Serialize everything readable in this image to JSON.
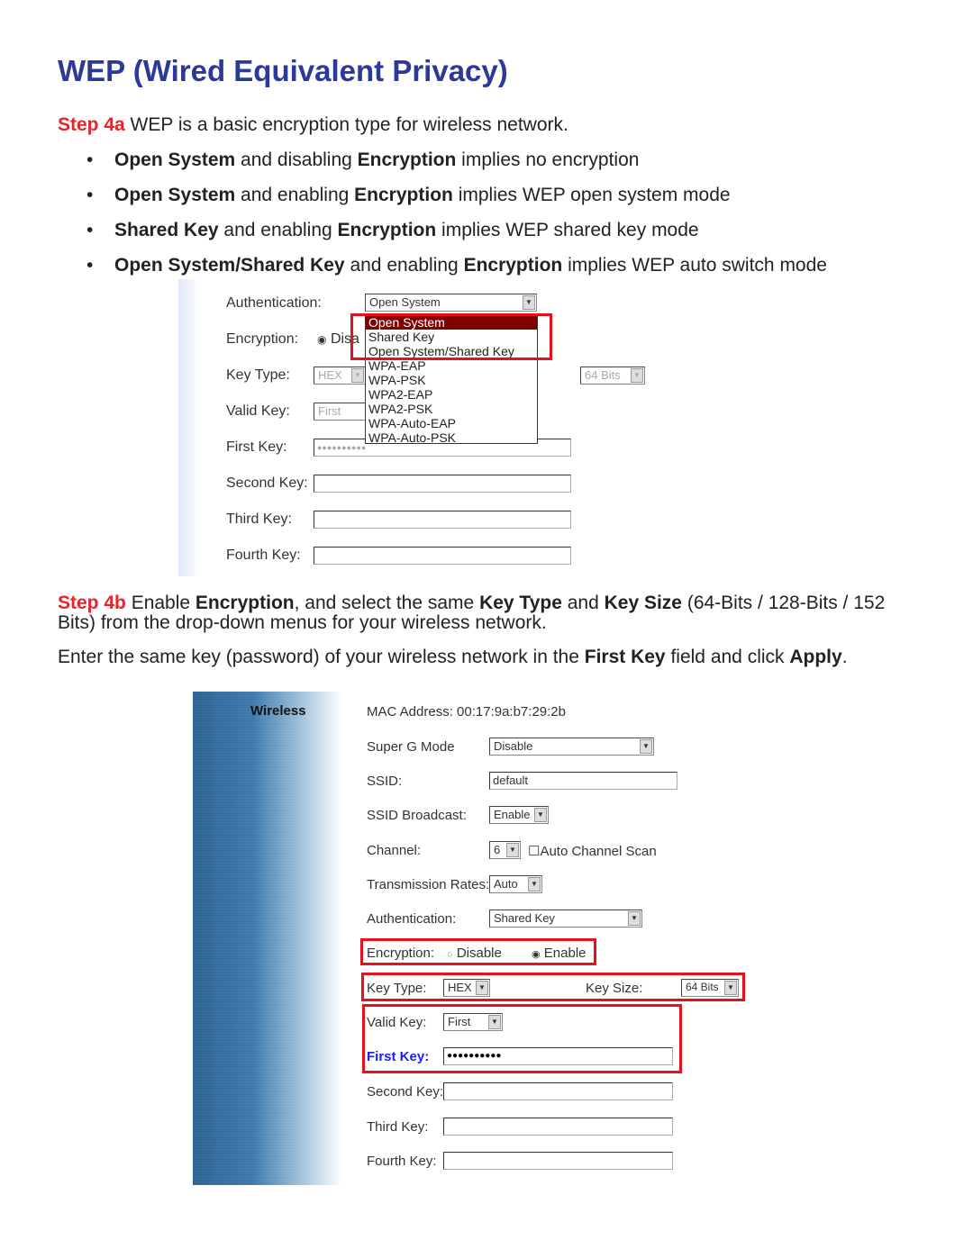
{
  "title": "WEP (Wired Equivalent Privacy)",
  "step4a": {
    "label": "Step 4a",
    "text": " WEP is a basic encryption type for wireless network."
  },
  "bullets": [
    [
      {
        "b": "Open System"
      },
      {
        "t": " and disabling "
      },
      {
        "b": "Encryption"
      },
      {
        "t": " implies no encryption"
      }
    ],
    [
      {
        "b": "Open System"
      },
      {
        "t": " and enabling "
      },
      {
        "b": "Encryption"
      },
      {
        "t": " implies WEP open system mode"
      }
    ],
    [
      {
        "b": "Shared Key"
      },
      {
        "t": " and enabling "
      },
      {
        "b": "Encryption"
      },
      {
        "t": " implies WEP shared key mode"
      }
    ],
    [
      {
        "b": "Open System/Shared Key"
      },
      {
        "t": " and enabling "
      },
      {
        "b": "Encryption"
      },
      {
        "t": " implies WEP auto switch mode"
      }
    ]
  ],
  "shot1": {
    "authentication_label": "Authentication:",
    "authentication_value": "Open System",
    "encryption_label": "Encryption:",
    "encryption_value": "Disa",
    "key_type_label": "Key Type:",
    "key_type_value": "HEX",
    "key_size_value": "64 Bits",
    "valid_key_label": "Valid Key:",
    "valid_key_value": "First",
    "first_key_label": "First Key:",
    "first_key_value": "●●●●●●●●●●",
    "second_key_label": "Second Key:",
    "third_key_label": "Third Key:",
    "fourth_key_label": "Fourth Key:",
    "options": [
      "Open System",
      "Shared Key",
      "Open System/Shared Key",
      "WPA-EAP",
      "WPA-PSK",
      "WPA2-EAP",
      "WPA2-PSK",
      "WPA-Auto-EAP",
      "WPA-Auto-PSK"
    ]
  },
  "step4b": {
    "label": "Step 4b",
    "line1": [
      {
        "t": " Enable "
      },
      {
        "b": "Encryption"
      },
      {
        "t": ", and select the same "
      },
      {
        "b": "Key Type"
      },
      {
        "t": " and "
      },
      {
        "b": "Key Size"
      },
      {
        "t": " (64-Bits / 128-Bits / 152"
      }
    ],
    "line2": "Bits) from the drop-down menus for your wireless network."
  },
  "para": [
    {
      "t": "Enter the same key (password) of your wireless network in the "
    },
    {
      "b": "First Key"
    },
    {
      "t": " field and click "
    },
    {
      "b": "Apply"
    },
    {
      "t": "."
    }
  ],
  "shot2": {
    "sidebar_title": "Wireless",
    "mac": "MAC Address: 00:17:9a:b7:29:2b",
    "super_g_label": "Super G Mode",
    "super_g_value": "Disable",
    "ssid_label": "SSID:",
    "ssid_value": "default",
    "ssid_broadcast_label": "SSID Broadcast:",
    "ssid_broadcast_value": "Enable",
    "channel_label": "Channel:",
    "channel_value": "6",
    "auto_scan_label": "Auto Channel Scan",
    "rates_label": "Transmission Rates:",
    "rates_value": "Auto",
    "auth_label": "Authentication:",
    "auth_value": "Shared Key",
    "encryption_label": "Encryption:",
    "disable_label": "Disable",
    "enable_label": "Enable",
    "key_type_label": "Key Type:",
    "key_type_value": "HEX",
    "key_size_label": "Key Size:",
    "key_size_value": "64 Bits",
    "valid_key_label": "Valid Key:",
    "valid_key_value": "First",
    "first_key_label": "First Key:",
    "first_key_value": "●●●●●●●●●●",
    "second_key_label": "Second Key:",
    "third_key_label": "Third Key:",
    "fourth_key_label": "Fourth Key:"
  },
  "colors": {
    "title": "#2b3a9a",
    "step": "#e8232a",
    "highlight_box": "#e8101a",
    "selected_option": "#800000",
    "first_key_label": "#1a1aff"
  }
}
